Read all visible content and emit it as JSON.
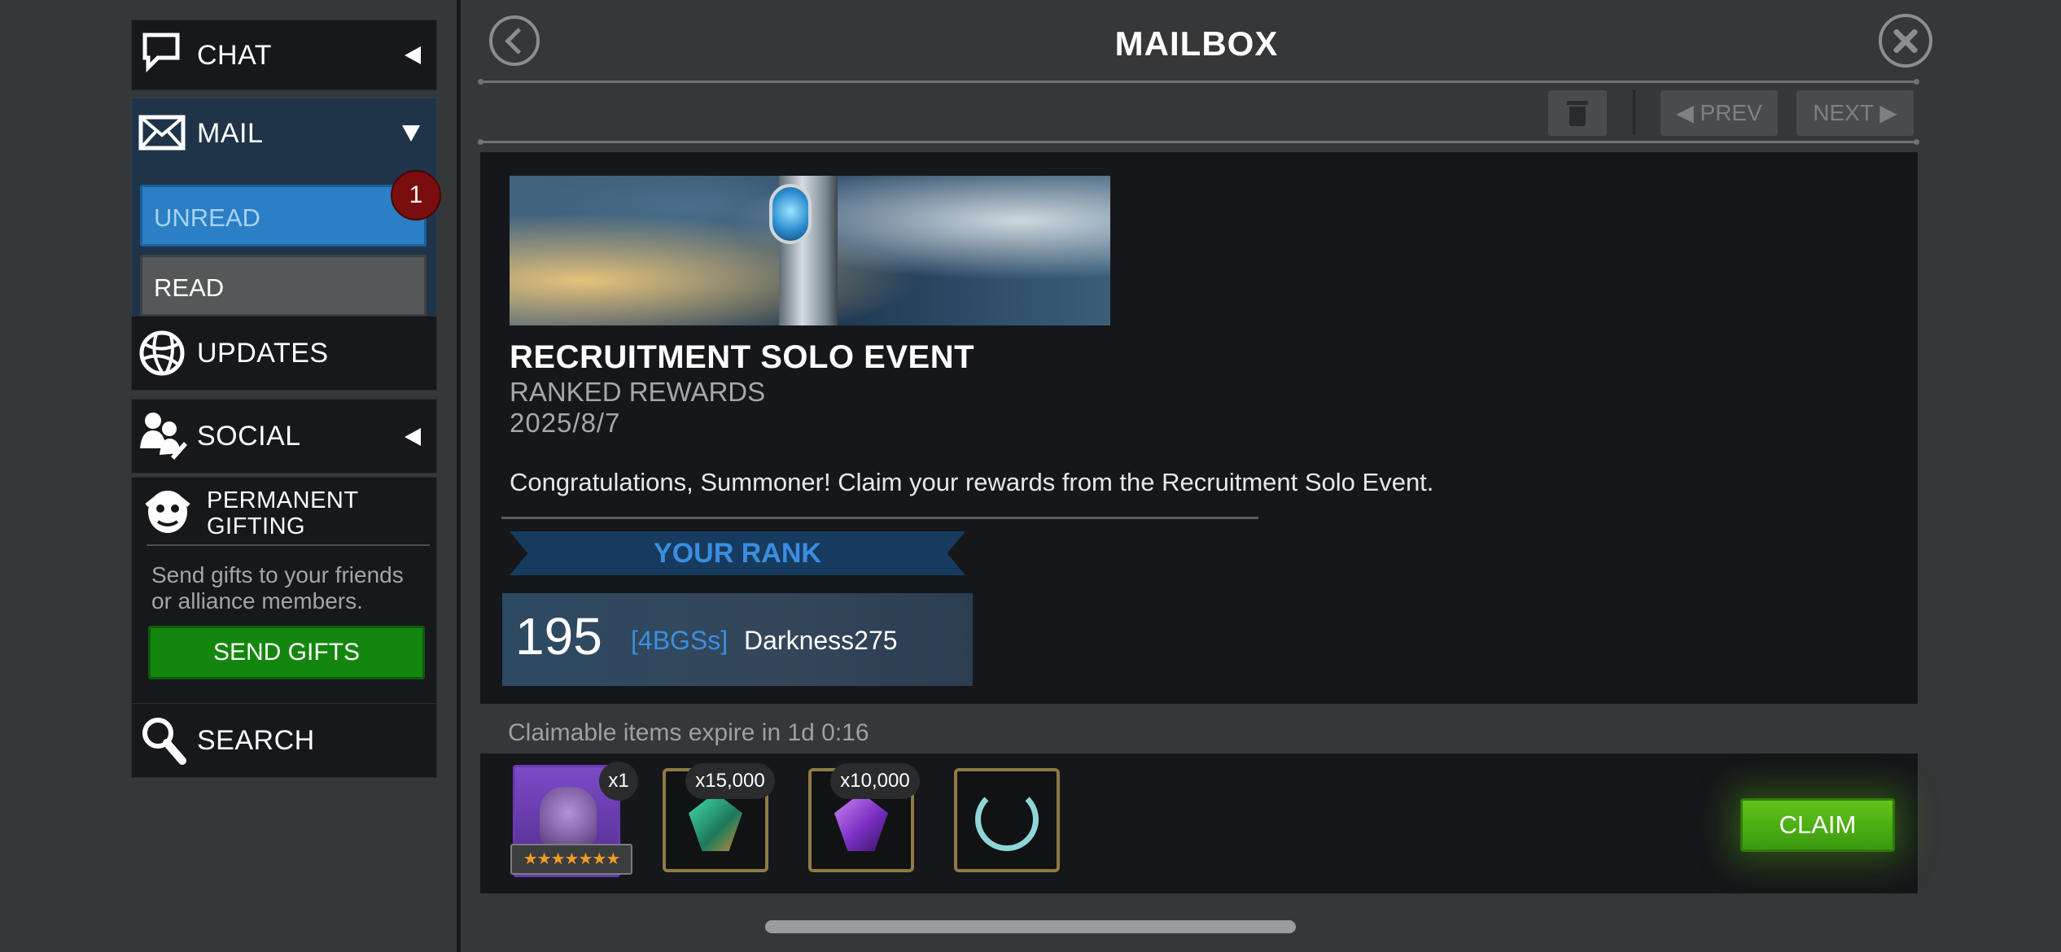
{
  "sidebar": {
    "chat": {
      "label": "CHAT"
    },
    "mail": {
      "label": "MAIL",
      "unread_label": "UNREAD",
      "unread_count": "1",
      "read_label": "READ"
    },
    "updates": {
      "label": "UPDATES"
    },
    "social": {
      "label": "SOCIAL"
    },
    "gifting": {
      "label": "PERMANENT GIFTING",
      "description": "Send gifts to your friends or alliance members.",
      "button": "SEND GIFTS"
    },
    "search": {
      "label": "SEARCH"
    }
  },
  "header": {
    "title": "MAILBOX"
  },
  "toolbar": {
    "prev_label": "◀ PREV",
    "next_label": "NEXT ▶"
  },
  "message": {
    "title": "RECRUITMENT SOLO EVENT",
    "subtitle": "RANKED REWARDS",
    "date": "2025/8/7",
    "body": "Congratulations, Summoner! Claim your rewards from the Recruitment Solo Event.",
    "rank_heading": "YOUR RANK",
    "rank": "195",
    "alliance_tag": "[4BGSs]",
    "player_name": "Darkness275"
  },
  "rewards": {
    "expiry_text": "Claimable items expire in 1d 0:16",
    "items": [
      {
        "icon": "champion-portrait-icon",
        "quantity": "x1",
        "stars": "★★★★★★★"
      },
      {
        "icon": "green-crystal-shard-icon",
        "quantity": "x15,000"
      },
      {
        "icon": "purple-crystal-shard-icon",
        "quantity": "x10,000"
      },
      {
        "icon": "laurel-wreath-icon",
        "quantity": ""
      }
    ],
    "claim_label": "CLAIM"
  },
  "colors": {
    "accent_blue": "#2b7fc4",
    "claim_green": "#4fb414",
    "send_green": "#13860d",
    "badge_red": "#7a0d0d"
  }
}
